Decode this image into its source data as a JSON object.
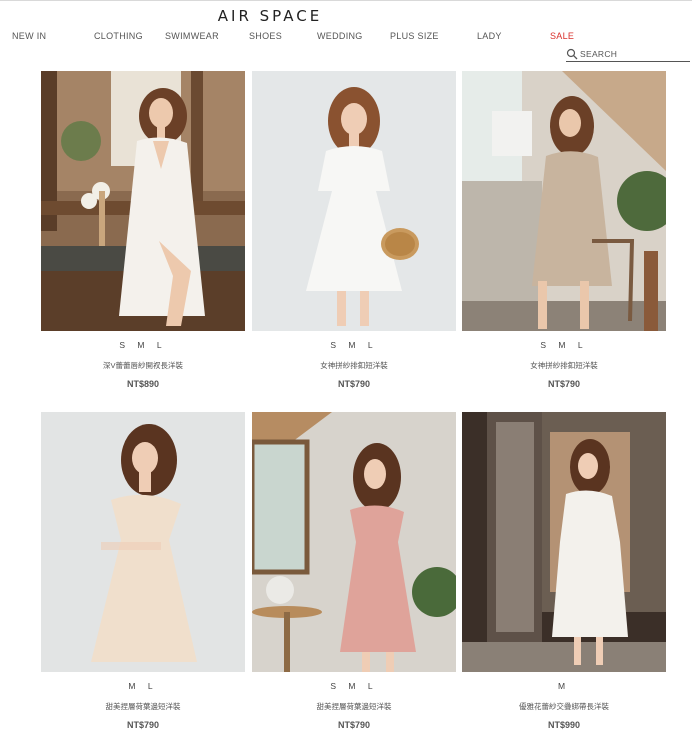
{
  "brand": "AIR SPACE",
  "nav": [
    {
      "label": "NEW IN",
      "key": "new-in"
    },
    {
      "label": "CLOTHING",
      "key": "clothing"
    },
    {
      "label": "SWIMWEAR",
      "key": "swimwear"
    },
    {
      "label": "SHOES",
      "key": "shoes"
    },
    {
      "label": "WEDDING",
      "key": "wedding"
    },
    {
      "label": "PLUS SIZE",
      "key": "plus-size"
    },
    {
      "label": "LADY",
      "key": "lady"
    },
    {
      "label": "SALE",
      "key": "sale"
    }
  ],
  "search": {
    "placeholder": "SEARCH"
  },
  "colors": {
    "sale": "#d9302c",
    "text": "#555555"
  },
  "products": [
    {
      "sizes": "S M L",
      "name": "深V蕾蕾唇紗開衩長洋裝",
      "price": "NT$890",
      "dress_color": "#f4f1ec",
      "scene": "wood bench interior"
    },
    {
      "sizes": "S M L",
      "name": "女神拼紗排釦短洋裝",
      "price": "NT$790",
      "dress_color": "#f6f6f4",
      "scene": "light grey studio"
    },
    {
      "sizes": "S M L",
      "name": "女神拼紗排釦短洋裝",
      "price": "NT$790",
      "dress_color": "#c8b49e",
      "scene": "balcony with plant"
    },
    {
      "sizes": "M L",
      "name": "甜美捏層荷葉邊短洋裝",
      "price": "NT$790",
      "dress_color": "#f0dfcc",
      "scene": "light grey studio"
    },
    {
      "sizes": "S M L",
      "name": "甜美捏層荷葉邊短洋裝",
      "price": "NT$790",
      "dress_color": "#dfa39a",
      "scene": "attic window"
    },
    {
      "sizes": "M",
      "name": "優雅花蕾紗交疊綁帶長洋裝",
      "price": "NT$990",
      "dress_color": "#f3f1ec",
      "scene": "cafe doorway"
    }
  ]
}
